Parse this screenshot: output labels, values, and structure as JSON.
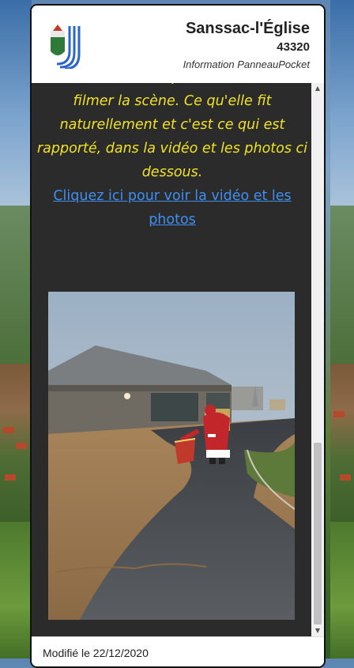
{
  "header": {
    "town_name": "Sanssac-l'Église",
    "postcode": "43320",
    "info_label": "Information PanneauPocket"
  },
  "content": {
    "text_lines": [
      "filmer la scène. Ce qu'elle fit",
      "naturellement et c'est ce qui est",
      "rapporté, dans la vidéo et les photos ci",
      "dessous."
    ],
    "link_lines": [
      "Cliquez ici pour voir la vidéo et les",
      "photos"
    ]
  },
  "footer": {
    "modified": "Modifié le 22/12/2020"
  },
  "colors": {
    "text_yellow": "#f0e224",
    "link_blue": "#3f8ff0",
    "content_bg": "#2b2b2b"
  }
}
